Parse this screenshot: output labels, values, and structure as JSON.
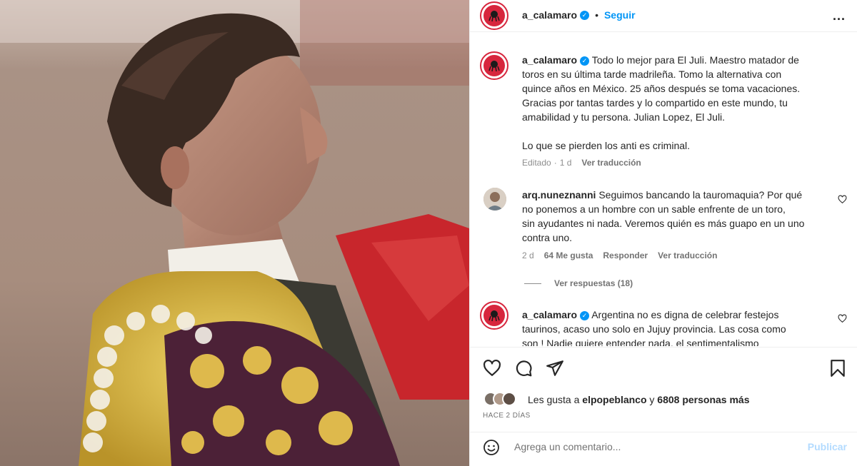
{
  "post": {
    "username": "a_calamaro",
    "follow_label": "Seguir",
    "separator": "•",
    "more_label": "...",
    "caption_line1": "Todo lo mejor para El Juli. Maestro matador de",
    "caption_lines": [
      "toros en su última tarde madrileña. Tomo la alternativa con",
      "quince años en México. 25 años después se toma vacaciones.",
      "Gracias por tantas tardes y lo compartido en este mundo, tu",
      "amabilidad y tu persona. Julian Lopez, El Juli."
    ],
    "caption_extra": "Lo que se pierden los anti es criminal.",
    "caption_meta": {
      "edited": "Editado",
      "dot": "·",
      "age": "1 d",
      "translate": "Ver traducción"
    }
  },
  "comments": [
    {
      "username": "arq.nuneznanni",
      "first_line": "Seguimos bancando la tauromaquia? Por qué",
      "lines": [
        "no ponemos a un hombre con un sable enfrente de un toro,",
        "sin ayudantes ni nada. Veremos quién es más guapo en un uno",
        "contra uno."
      ],
      "age": "2 d",
      "likes": "64 Me gusta",
      "reply": "Responder",
      "translate": "Ver traducción",
      "view_replies": "Ver respuestas (18)"
    },
    {
      "username": "a_calamaro",
      "first_line": "Argentina no es digna de celebrar festejos",
      "lines": [
        "taurinos, acaso uno solo en Jujuy provincia. Las cosa como",
        "son ! Nadie quiere entender nada, el sentimentalismo"
      ]
    }
  ],
  "likes": {
    "prefix": "Les gusta a",
    "user": "elpopeblanco",
    "conj": "y",
    "count": "6808 personas más"
  },
  "timestamp": "HACE 2 DÍAS",
  "comment_box": {
    "placeholder": "Agrega un comentario...",
    "publish": "Publicar"
  },
  "colors": {
    "accent": "#0095f6",
    "avatar_red": "#d7263d",
    "cape_red": "#c8262c",
    "gold": "#d9b640"
  },
  "icons": [
    "verified-icon",
    "more-icon",
    "heart-icon",
    "comment-icon",
    "share-icon",
    "bookmark-icon",
    "emoji-icon"
  ]
}
